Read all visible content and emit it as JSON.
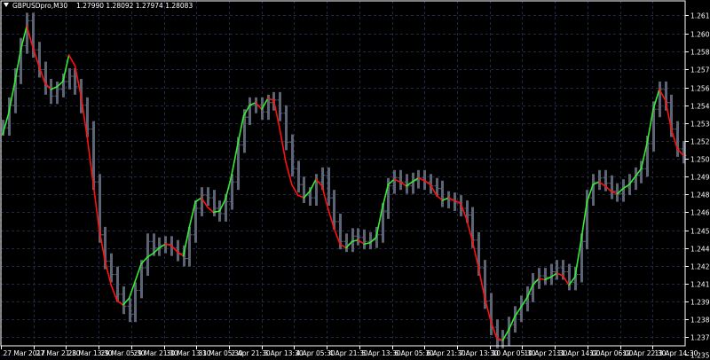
{
  "header": {
    "symbol": "GBPUSDpro,M30",
    "quotes": "1.27990 1.28092 1.27974 1.28083"
  },
  "colors": {
    "background": "#000000",
    "grid": "#1e2a44",
    "candles": "#5b6374",
    "ma_rising": "#33ee33",
    "ma_falling": "#ff1111",
    "text": "#ffffff"
  },
  "chart_data": {
    "type": "line",
    "grid": true,
    "ylim": [
      1.2366,
      1.2627
    ],
    "y_ticks": [
      "1.26160",
      "1.26025",
      "1.25890",
      "1.25755",
      "1.25615",
      "1.25480",
      "1.25345",
      "1.25210",
      "1.25075",
      "1.24940",
      "1.24805",
      "1.24670",
      "1.24535",
      "1.24400",
      "1.24265",
      "1.24130",
      "1.23995",
      "1.23860",
      "1.23725",
      "1.23590"
    ],
    "x_ticks": [
      "27 Mar 2017",
      "27 Mar 21:30",
      "28 Mar 13:30",
      "29 Mar 05:30",
      "29 Mar 21:30",
      "30 Mar 13:30",
      "31 Mar 05:30",
      "2 Apr 21:30",
      "3 Apr 13:30",
      "4 Apr 05:30",
      "4 Apr 21:30",
      "5 Apr 13:30",
      "6 Apr 05:30",
      "6 Apr 21:30",
      "7 Apr 13:30",
      "10 Apr 05:30",
      "10 Apr 21:30",
      "11 Apr 14:00",
      "12 Apr 06:00",
      "12 Apr 22:30",
      "13 Apr 14:30"
    ],
    "series": [
      {
        "kind": "close",
        "values": [
          1.2531,
          1.2548,
          1.257,
          1.2593,
          1.2612,
          1.259,
          1.2575,
          1.2562,
          1.2555,
          1.256,
          1.2566,
          1.257,
          1.2562,
          1.2548,
          1.253,
          1.249,
          1.245,
          1.243,
          1.242,
          1.2405,
          1.2396,
          1.239,
          1.2408,
          1.2425,
          1.2445,
          1.244,
          1.2442,
          1.2443,
          1.244,
          1.2436,
          1.2432,
          1.245,
          1.247,
          1.248,
          1.2478,
          1.247,
          1.2466,
          1.2475,
          1.249,
          1.2518,
          1.2539,
          1.2548,
          1.2548,
          1.2543,
          1.255,
          1.2552,
          1.2542,
          1.252,
          1.25,
          1.2488,
          1.248,
          1.2478,
          1.249,
          1.2495,
          1.2478,
          1.246,
          1.2445,
          1.2443,
          1.2449,
          1.2448,
          1.2445,
          1.2446,
          1.245,
          1.2468,
          1.2487,
          1.2493,
          1.249,
          1.2487,
          1.2491,
          1.2493,
          1.249,
          1.2487,
          1.2485,
          1.2477,
          1.2476,
          1.2474,
          1.247,
          1.2465,
          1.2446,
          1.2425,
          1.24,
          1.238,
          1.237,
          1.2372,
          1.2382,
          1.239,
          1.2398,
          1.2405,
          1.2415,
          1.2419,
          1.2418,
          1.2422,
          1.2425,
          1.2422,
          1.2414,
          1.242,
          1.2445,
          1.2478,
          1.249,
          1.2493,
          1.2489,
          1.2483,
          1.2481,
          1.2486,
          1.249,
          1.2495,
          1.25,
          1.2519,
          1.2545,
          1.256,
          1.255,
          1.253,
          1.2515,
          1.251
        ]
      },
      {
        "kind": "moving-average",
        "values": [
          1.2526,
          1.2542,
          1.2565,
          1.259,
          1.2608,
          1.2592,
          1.2578,
          1.2565,
          1.256,
          1.2562,
          1.2566,
          1.2586,
          1.2578,
          1.2555,
          1.2525,
          1.249,
          1.2455,
          1.243,
          1.2412,
          1.24,
          1.2397,
          1.2402,
          1.2415,
          1.2428,
          1.2433,
          1.2436,
          1.244,
          1.2443,
          1.2442,
          1.2437,
          1.2434,
          1.2456,
          1.2475,
          1.2478,
          1.2471,
          1.2467,
          1.2468,
          1.2477,
          1.2495,
          1.2518,
          1.254,
          1.2548,
          1.255,
          1.2545,
          1.2553,
          1.2552,
          1.253,
          1.2505,
          1.2488,
          1.248,
          1.2478,
          1.2483,
          1.2492,
          1.2487,
          1.247,
          1.2455,
          1.2443,
          1.244,
          1.2445,
          1.2446,
          1.2443,
          1.2444,
          1.2448,
          1.247,
          1.2488,
          1.2492,
          1.249,
          1.2487,
          1.249,
          1.2493,
          1.2491,
          1.2488,
          1.248,
          1.2476,
          1.2478,
          1.2476,
          1.2474,
          1.2462,
          1.2445,
          1.2425,
          1.2403,
          1.2385,
          1.2372,
          1.237,
          1.2378,
          1.2388,
          1.2395,
          1.2402,
          1.2412,
          1.2417,
          1.2416,
          1.2418,
          1.2421,
          1.2419,
          1.2412,
          1.2418,
          1.2445,
          1.2475,
          1.2488,
          1.249,
          1.2487,
          1.2483,
          1.2481,
          1.2485,
          1.2488,
          1.2494,
          1.25,
          1.252,
          1.2545,
          1.256,
          1.2552,
          1.253,
          1.2515,
          1.251
        ]
      }
    ]
  }
}
